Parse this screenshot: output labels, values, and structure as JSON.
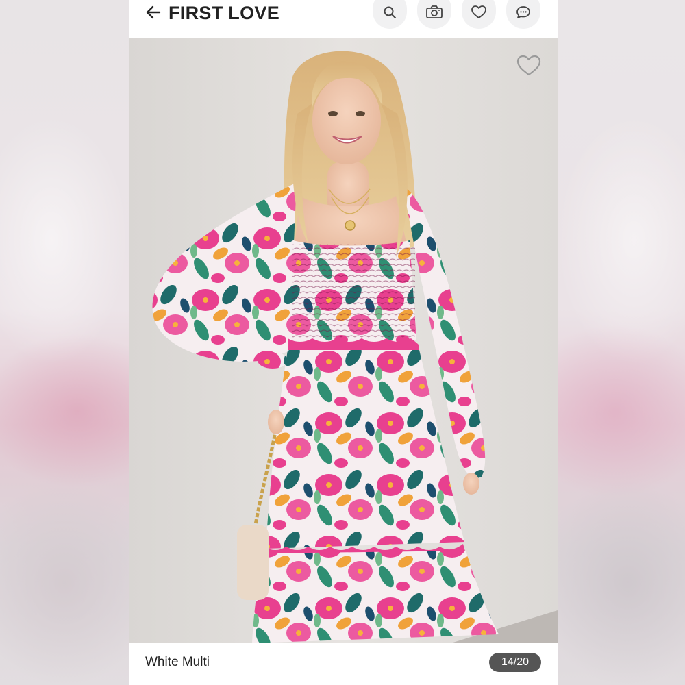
{
  "header": {
    "title": "FIRST LOVE",
    "back_icon": "arrow-left-icon",
    "actions": [
      "search-icon",
      "camera-icon",
      "heart-icon",
      "chat-icon"
    ]
  },
  "photo": {
    "description_icon": "heart-outline-icon"
  },
  "footer": {
    "variant": "White Multi",
    "counter": "14/20"
  },
  "colors": {
    "title": "#222222",
    "counter_bg": "#555555",
    "icon_bg": "#f1f1f2",
    "dress_pink": "#e8408f",
    "dress_teal": "#1f6b6a",
    "dress_orange": "#f0a23a"
  }
}
